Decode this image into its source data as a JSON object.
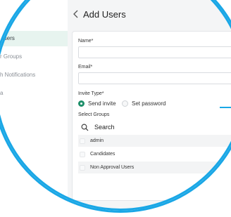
{
  "sidebar": {
    "items": [
      {
        "label": "Users",
        "active": true
      },
      {
        "label": "r Groups",
        "active": false
      },
      {
        "label": "h Notifications",
        "active": false
      },
      {
        "label": "a",
        "active": false
      }
    ]
  },
  "header": {
    "back_icon": "chevron-left-icon",
    "title": "Add Users"
  },
  "form": {
    "name_label": "Name*",
    "name_value": "",
    "email_label": "Email*",
    "email_value": "",
    "invite_type_label": "Invite Type*",
    "invite_options": [
      {
        "label": "Send invite",
        "selected": true
      },
      {
        "label": "Set password",
        "selected": false
      }
    ],
    "groups_label": "Select Groups",
    "search_placeholder": "Search",
    "search_icon": "search-icon",
    "groups": [
      {
        "label": "admin",
        "checked": false
      },
      {
        "label": "Candidates",
        "checked": false
      },
      {
        "label": "Non Approval Users",
        "checked": false
      }
    ]
  },
  "colors": {
    "accent_ring": "#1aa7e6",
    "radio_selected": "#1e8f6a",
    "active_nav_bg": "#e7f4ef"
  }
}
